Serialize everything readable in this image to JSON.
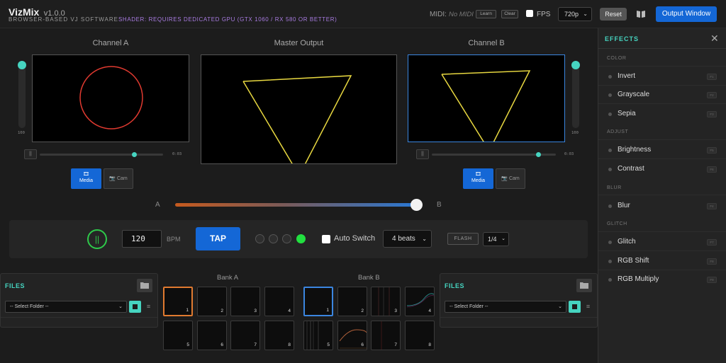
{
  "header": {
    "app_name": "VizMix",
    "version": "v1.0.0",
    "subtitle": "BROWSER-BASED VJ SOFTWARE",
    "shader_notice": "SHADER: REQUIRES DEDICATED GPU (GTX 1060 / RX 580 OR BETTER)",
    "midi_label": "MIDI:",
    "midi_status": "No MIDI",
    "learn_label": "Learn",
    "clear_label": "Clear",
    "fps_label": "FPS",
    "fps_checked": false,
    "resolution": "720p",
    "reset_label": "Reset",
    "book_icon": "book-icon",
    "output_label": "Output Window"
  },
  "channel_a": {
    "title": "Channel A",
    "opacity_value": "100",
    "time": "0:03",
    "pause_icon": "pause-icon",
    "media_label": "Media",
    "cam_label": "Cam",
    "shape": "circle",
    "stroke_color": "#e03a30"
  },
  "master": {
    "title": "Master Output",
    "shape": "triangle",
    "stroke_color": "#e8d840"
  },
  "channel_b": {
    "title": "Channel B",
    "opacity_value": "100",
    "time": "0:03",
    "pause_icon": "pause-icon",
    "media_label": "Media",
    "cam_label": "Cam",
    "shape": "triangle",
    "stroke_color": "#e8d840"
  },
  "crossfader": {
    "left_label": "A",
    "right_label": "B",
    "value": 1.0
  },
  "controls": {
    "beat_icon": "pause-icon",
    "bpm": "120",
    "bpm_label": "BPM",
    "tap_label": "TAP",
    "beat_dots": [
      false,
      false,
      false,
      true
    ],
    "auto_switch_label": "Auto Switch",
    "auto_switch_checked": false,
    "beats_value": "4 beats",
    "flash_label": "FLASH",
    "fraction_value": "1/4"
  },
  "files_left": {
    "title": "FILES",
    "folder_placeholder": "-- Select Folder --"
  },
  "files_right": {
    "title": "FILES",
    "folder_placeholder": "-- Select Folder --"
  },
  "bank_a": {
    "title": "Bank A",
    "slots": [
      "1",
      "2",
      "3",
      "4",
      "5",
      "6",
      "7",
      "8"
    ]
  },
  "bank_b": {
    "title": "Bank B",
    "slots": [
      "1",
      "2",
      "3",
      "4",
      "5",
      "6",
      "7",
      "8"
    ]
  },
  "effects": {
    "title": "EFFECTS",
    "categories": [
      {
        "name": "COLOR",
        "items": [
          {
            "label": "Invert",
            "key": "F1"
          },
          {
            "label": "Grayscale",
            "key": "F2"
          },
          {
            "label": "Sepia",
            "key": "F3"
          }
        ]
      },
      {
        "name": "ADJUST",
        "items": [
          {
            "label": "Brightness",
            "key": "F5"
          },
          {
            "label": "Contrast",
            "key": "F6"
          }
        ]
      },
      {
        "name": "BLUR",
        "items": [
          {
            "label": "Blur",
            "key": "F4"
          }
        ]
      },
      {
        "name": "GLITCH",
        "items": [
          {
            "label": "Glitch",
            "key": "F7"
          },
          {
            "label": "RGB Shift",
            "key": "F8"
          },
          {
            "label": "RGB Multiply",
            "key": "F9"
          }
        ]
      }
    ]
  },
  "colors": {
    "accent": "#46d4c0",
    "primary": "#1467d6",
    "beat_on": "#22e040"
  }
}
